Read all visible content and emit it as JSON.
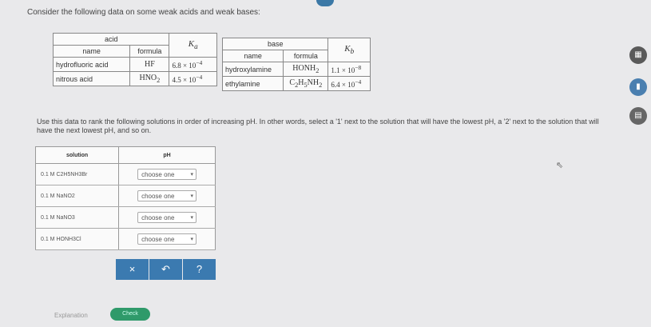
{
  "intro": "Consider the following data on some weak acids and weak bases:",
  "acid_table": {
    "group_header": "acid",
    "col_name": "name",
    "col_formula": "formula",
    "k_symbol": "K",
    "k_sub": "a",
    "rows": [
      {
        "name": "hydrofluoric acid",
        "formula": "HF",
        "k_mant": "6.8 × 10",
        "k_exp": "−4"
      },
      {
        "name": "nitrous acid",
        "formula_main": "HNO",
        "formula_sub": "2",
        "k_mant": "4.5 × 10",
        "k_exp": "−4"
      }
    ]
  },
  "base_table": {
    "group_header": "base",
    "col_name": "name",
    "col_formula": "formula",
    "k_symbol": "K",
    "k_sub": "b",
    "rows": [
      {
        "name": "hydroxylamine",
        "f1": "HONH",
        "f1s": "2",
        "k_mant": "1.1 × 10",
        "k_exp": "−8"
      },
      {
        "name": "ethylamine",
        "f1": "C",
        "f1s": "2",
        "f2": "H",
        "f2s": "5",
        "f3": "NH",
        "f3s": "2",
        "k_mant": "6.4 × 10",
        "k_exp": "−4"
      }
    ]
  },
  "instruction": "Use this data to rank the following solutions in order of increasing pH. In other words, select a '1' next to the solution that will have the lowest pH, a '2' next to the solution that will have the next lowest pH, and so on.",
  "solutions_table": {
    "col_solution": "solution",
    "col_ph": "pH",
    "rows": [
      {
        "solution": "0.1 M C2H5NH3Br",
        "choice": "choose one"
      },
      {
        "solution": "0.1 M NaNO2",
        "choice": "choose one"
      },
      {
        "solution": "0.1 M NaNO3",
        "choice": "choose one"
      },
      {
        "solution": "0.1 M HONH3Cl",
        "choice": "choose one"
      }
    ]
  },
  "buttons": {
    "clear": "×",
    "undo": "↶",
    "help": "?"
  },
  "footer": {
    "explanation": "Explanation",
    "check": "Check"
  },
  "side_icons": [
    "calculator-icon",
    "chart-icon",
    "periodic-table-icon"
  ]
}
